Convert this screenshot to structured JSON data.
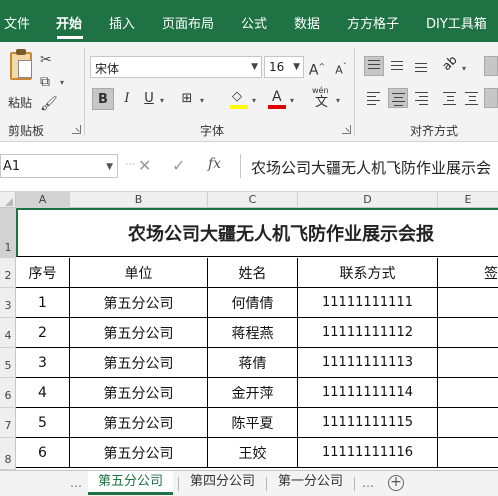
{
  "ribbon_tabs": [
    "文件",
    "开始",
    "插入",
    "页面布局",
    "公式",
    "数据",
    "方方格子",
    "DIY工具箱"
  ],
  "active_tab": "开始",
  "clipboard": {
    "paste_label": "粘贴",
    "group_label": "剪贴板"
  },
  "font": {
    "name": "宋体",
    "size": "16",
    "group_label": "字体",
    "bold": "B",
    "italic": "I",
    "underline": "U",
    "grow": "A",
    "shrink": "A",
    "phonetic": "wén",
    "phonetic_char": "文",
    "font_color_letter": "A",
    "fill_color": "#ffff00",
    "font_color": "#e00000"
  },
  "alignment": {
    "group_label": "对齐方式"
  },
  "formula_bar": {
    "name_box": "A1",
    "cancel": "✕",
    "enter": "✓",
    "fx": "fx",
    "content": "农场公司大疆无人机飞防作业展示会"
  },
  "columns": [
    "A",
    "B",
    "C",
    "D",
    "E"
  ],
  "rows": [
    "1",
    "2",
    "3",
    "4",
    "5",
    "6",
    "7",
    "8"
  ],
  "sheet": {
    "title": "农场公司大疆无人机飞防作业展示会报",
    "headers": [
      "序号",
      "单位",
      "姓名",
      "联系方式",
      "签"
    ],
    "records": [
      {
        "seq": "1",
        "unit": "第五分公司",
        "name": "何倩倩",
        "phone": "11111111111"
      },
      {
        "seq": "2",
        "unit": "第五分公司",
        "name": "蒋程燕",
        "phone": "11111111112"
      },
      {
        "seq": "3",
        "unit": "第五分公司",
        "name": "蒋倩",
        "phone": "11111111113"
      },
      {
        "seq": "4",
        "unit": "第五分公司",
        "name": "金开萍",
        "phone": "11111111114"
      },
      {
        "seq": "5",
        "unit": "第五分公司",
        "name": "陈平夏",
        "phone": "11111111115"
      },
      {
        "seq": "6",
        "unit": "第五分公司",
        "name": "王姣",
        "phone": "11111111116"
      }
    ]
  },
  "sheet_tabs": [
    "第五分公司",
    "第四分公司",
    "第一分公司"
  ],
  "active_sheet": "第五分公司",
  "accent_color": "#1f7244"
}
